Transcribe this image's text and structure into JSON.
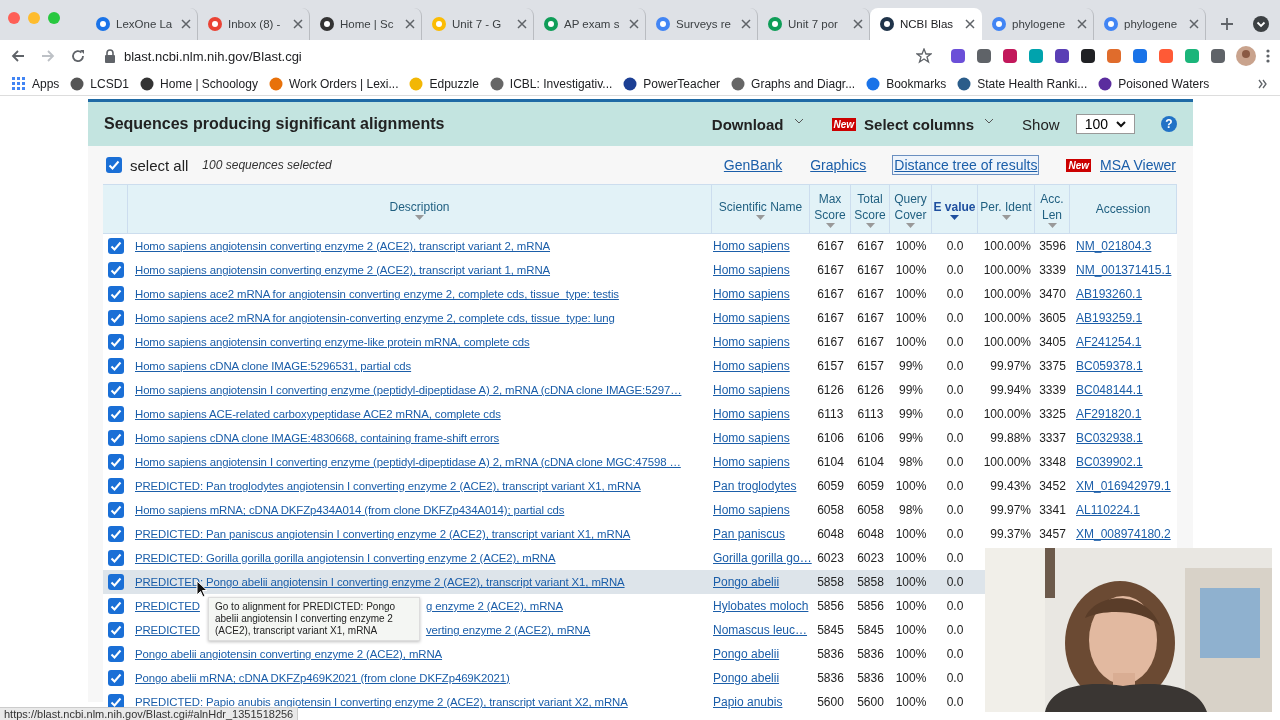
{
  "browser": {
    "tabs": [
      {
        "title": "LexOne La",
        "color": "#1a73e8",
        "selected": false
      },
      {
        "title": "Inbox (8) -",
        "color": "#ea4335",
        "selected": false
      },
      {
        "title": "Home | Sc",
        "color": "#333333",
        "selected": false
      },
      {
        "title": "Unit 7 - G",
        "color": "#fbbc04",
        "selected": false
      },
      {
        "title": "AP exam s",
        "color": "#0f9d58",
        "selected": false
      },
      {
        "title": "Surveys re",
        "color": "#4285f4",
        "selected": false
      },
      {
        "title": "Unit 7 por",
        "color": "#0f9d58",
        "selected": false
      },
      {
        "title": "NCBI Blas",
        "color": "#20344a",
        "selected": true
      },
      {
        "title": "phylogene",
        "color": "#4285f4",
        "selected": false
      },
      {
        "title": "phylogene",
        "color": "#4285f4",
        "selected": false
      }
    ],
    "url": "blast.ncbi.nlm.nih.gov/Blast.cgi",
    "bookmarks": [
      {
        "title": "Apps",
        "color": "#4285f4"
      },
      {
        "title": "LCSD1",
        "color": "#555555"
      },
      {
        "title": "Home | Schoology",
        "color": "#333333"
      },
      {
        "title": "Work Orders | Lexi...",
        "color": "#e8710a"
      },
      {
        "title": "Edpuzzle",
        "color": "#f2b705"
      },
      {
        "title": "ICBL: Investigativ...",
        "color": "#666666"
      },
      {
        "title": "PowerTeacher",
        "color": "#1c3f94"
      },
      {
        "title": "Graphs and Diagr...",
        "color": "#666666"
      },
      {
        "title": "Bookmarks",
        "color": "#1a73e8"
      },
      {
        "title": "State Health Ranki...",
        "color": "#2b5d8a"
      },
      {
        "title": "Poisoned Waters",
        "color": "#5b2d9e"
      }
    ]
  },
  "results": {
    "title": "Sequences producing significant alignments",
    "download": "Download",
    "new_badge": "New",
    "select_columns": "Select columns",
    "show_label": "Show",
    "show_value": "100",
    "help": "?",
    "select_all": {
      "label": "select all",
      "checked": true
    },
    "selected_count": "100 sequences selected",
    "links": [
      {
        "label": "GenBank",
        "focused": false,
        "new": false
      },
      {
        "label": "Graphics",
        "focused": false,
        "new": false
      },
      {
        "label": "Distance tree of results",
        "focused": true,
        "new": false
      },
      {
        "label": "MSA Viewer",
        "focused": false,
        "new": true
      }
    ],
    "new_link_badge": "New",
    "columns": [
      {
        "label": "Description",
        "sorted": false,
        "sortable": true
      },
      {
        "label": "Scientific Name",
        "sorted": false,
        "sortable": true
      },
      {
        "label": "Max Score",
        "sorted": false,
        "sortable": true
      },
      {
        "label": "Total Score",
        "sorted": false,
        "sortable": true
      },
      {
        "label": "Query Cover",
        "sorted": false,
        "sortable": true
      },
      {
        "label": "E value",
        "sorted": true,
        "sortable": true
      },
      {
        "label": "Per. Ident",
        "sorted": false,
        "sortable": true
      },
      {
        "label": "Acc. Len",
        "sorted": false,
        "sortable": true
      },
      {
        "label": "Accession",
        "sorted": false,
        "sortable": false
      }
    ],
    "rows": [
      {
        "checked": true,
        "hovered": false,
        "description": "Homo sapiens angiotensin converting enzyme 2 (ACE2), transcript variant 2, mRNA",
        "scientific_name": "Homo sapiens",
        "max_score": "6167",
        "total_score": "6167",
        "query_cover": "100%",
        "e_value": "0.0",
        "per_ident": "100.00%",
        "acc_len": "3596",
        "accession": "NM_021804.3"
      },
      {
        "checked": true,
        "hovered": false,
        "description": "Homo sapiens angiotensin converting enzyme 2 (ACE2), transcript variant 1, mRNA",
        "scientific_name": "Homo sapiens",
        "max_score": "6167",
        "total_score": "6167",
        "query_cover": "100%",
        "e_value": "0.0",
        "per_ident": "100.00%",
        "acc_len": "3339",
        "accession": "NM_001371415.1"
      },
      {
        "checked": true,
        "hovered": false,
        "description": "Homo sapiens ace2 mRNA for angiotensin converting enzyme 2, complete cds, tissue_type: testis",
        "scientific_name": "Homo sapiens",
        "max_score": "6167",
        "total_score": "6167",
        "query_cover": "100%",
        "e_value": "0.0",
        "per_ident": "100.00%",
        "acc_len": "3470",
        "accession": "AB193260.1"
      },
      {
        "checked": true,
        "hovered": false,
        "description": "Homo sapiens ace2 mRNA for angiotensin-converting enzyme 2, complete cds, tissue_type: lung",
        "scientific_name": "Homo sapiens",
        "max_score": "6167",
        "total_score": "6167",
        "query_cover": "100%",
        "e_value": "0.0",
        "per_ident": "100.00%",
        "acc_len": "3605",
        "accession": "AB193259.1"
      },
      {
        "checked": true,
        "hovered": false,
        "description": "Homo sapiens angiotensin converting enzyme-like protein mRNA, complete cds",
        "scientific_name": "Homo sapiens",
        "max_score": "6167",
        "total_score": "6167",
        "query_cover": "100%",
        "e_value": "0.0",
        "per_ident": "100.00%",
        "acc_len": "3405",
        "accession": "AF241254.1"
      },
      {
        "checked": true,
        "hovered": false,
        "description": "Homo sapiens cDNA clone IMAGE:5296531, partial cds",
        "scientific_name": "Homo sapiens",
        "max_score": "6157",
        "total_score": "6157",
        "query_cover": "99%",
        "e_value": "0.0",
        "per_ident": "99.97%",
        "acc_len": "3375",
        "accession": "BC059378.1"
      },
      {
        "checked": true,
        "hovered": false,
        "description": "Homo sapiens angiotensin I converting enzyme (peptidyl-dipeptidase A) 2, mRNA (cDNA clone IMAGE:5297…",
        "scientific_name": "Homo sapiens",
        "max_score": "6126",
        "total_score": "6126",
        "query_cover": "99%",
        "e_value": "0.0",
        "per_ident": "99.94%",
        "acc_len": "3339",
        "accession": "BC048144.1"
      },
      {
        "checked": true,
        "hovered": false,
        "description": "Homo sapiens ACE-related carboxypeptidase ACE2 mRNA, complete cds",
        "scientific_name": "Homo sapiens",
        "max_score": "6113",
        "total_score": "6113",
        "query_cover": "99%",
        "e_value": "0.0",
        "per_ident": "100.00%",
        "acc_len": "3325",
        "accession": "AF291820.1"
      },
      {
        "checked": true,
        "hovered": false,
        "description": "Homo sapiens cDNA clone IMAGE:4830668, containing frame-shift errors",
        "scientific_name": "Homo sapiens",
        "max_score": "6106",
        "total_score": "6106",
        "query_cover": "99%",
        "e_value": "0.0",
        "per_ident": "99.88%",
        "acc_len": "3337",
        "accession": "BC032938.1"
      },
      {
        "checked": true,
        "hovered": false,
        "description": "Homo sapiens angiotensin I converting enzyme (peptidyl-dipeptidase A) 2, mRNA (cDNA clone MGC:47598 …",
        "scientific_name": "Homo sapiens",
        "max_score": "6104",
        "total_score": "6104",
        "query_cover": "98%",
        "e_value": "0.0",
        "per_ident": "100.00%",
        "acc_len": "3348",
        "accession": "BC039902.1"
      },
      {
        "checked": true,
        "hovered": false,
        "description": "PREDICTED: Pan troglodytes angiotensin I converting enzyme 2 (ACE2), transcript variant X1, mRNA",
        "scientific_name": "Pan troglodytes",
        "max_score": "6059",
        "total_score": "6059",
        "query_cover": "100%",
        "e_value": "0.0",
        "per_ident": "99.43%",
        "acc_len": "3452",
        "accession": "XM_016942979.1"
      },
      {
        "checked": true,
        "hovered": false,
        "description": "Homo sapiens mRNA; cDNA DKFZp434A014 (from clone DKFZp434A014); partial cds",
        "scientific_name": "Homo sapiens",
        "max_score": "6058",
        "total_score": "6058",
        "query_cover": "98%",
        "e_value": "0.0",
        "per_ident": "99.97%",
        "acc_len": "3341",
        "accession": "AL110224.1"
      },
      {
        "checked": true,
        "hovered": false,
        "description": "PREDICTED: Pan paniscus angiotensin I converting enzyme 2 (ACE2), transcript variant X1, mRNA",
        "scientific_name": "Pan paniscus",
        "max_score": "6048",
        "total_score": "6048",
        "query_cover": "100%",
        "e_value": "0.0",
        "per_ident": "99.37%",
        "acc_len": "3457",
        "accession": "XM_008974180.2"
      },
      {
        "checked": true,
        "hovered": false,
        "description": "PREDICTED: Gorilla gorilla gorilla angiotensin I converting enzyme 2 (ACE2), mRNA",
        "scientific_name": "Gorilla gorilla go…",
        "max_score": "6023",
        "total_score": "6023",
        "query_cover": "100%",
        "e_value": "0.0"
      },
      {
        "checked": true,
        "hovered": true,
        "description": "PREDICTED: Pongo abelii angiotensin I converting enzyme 2 (ACE2), transcript variant X1, mRNA",
        "scientific_name": "Pongo abelii",
        "max_score": "5858",
        "total_score": "5858",
        "query_cover": "100%",
        "e_value": "0.0"
      },
      {
        "checked": true,
        "hovered": false,
        "description_parts": [
          "PREDICTED",
          "g enzyme 2 (ACE2), mRNA"
        ],
        "scientific_name": "Hylobates moloch",
        "max_score": "5856",
        "total_score": "5856",
        "query_cover": "100%",
        "e_value": "0.0"
      },
      {
        "checked": true,
        "hovered": false,
        "description_parts": [
          "PREDICTED",
          "verting enzyme 2 (ACE2), mRNA"
        ],
        "scientific_name": "Nomascus leuc…",
        "max_score": "5845",
        "total_score": "5845",
        "query_cover": "100%",
        "e_value": "0.0"
      },
      {
        "checked": true,
        "hovered": false,
        "description": "Pongo abelii angiotensin converting enzyme 2 (ACE2), mRNA",
        "scientific_name": "Pongo abelii",
        "max_score": "5836",
        "total_score": "5836",
        "query_cover": "100%",
        "e_value": "0.0"
      },
      {
        "checked": true,
        "hovered": false,
        "description": "Pongo abelii mRNA; cDNA DKFZp469K2021 (from clone DKFZp469K2021)",
        "scientific_name": "Pongo abelii",
        "max_score": "5836",
        "total_score": "5836",
        "query_cover": "100%",
        "e_value": "0.0"
      },
      {
        "checked": true,
        "hovered": false,
        "description": "PREDICTED: Papio anubis angiotensin I converting enzyme 2 (ACE2), transcript variant X2, mRNA",
        "scientific_name": "Papio anubis",
        "max_score": "5600",
        "total_score": "5600",
        "query_cover": "100%",
        "e_value": "0.0"
      }
    ],
    "tooltip": "Go to alignment for PREDICTED: Pongo abelii angiotensin I converting enzyme 2 (ACE2), transcript variant X1, mRNA"
  },
  "status_bar": "https://blast.ncbi.nlm.nih.gov/Blast.cgi#alnHdr_1351518256"
}
